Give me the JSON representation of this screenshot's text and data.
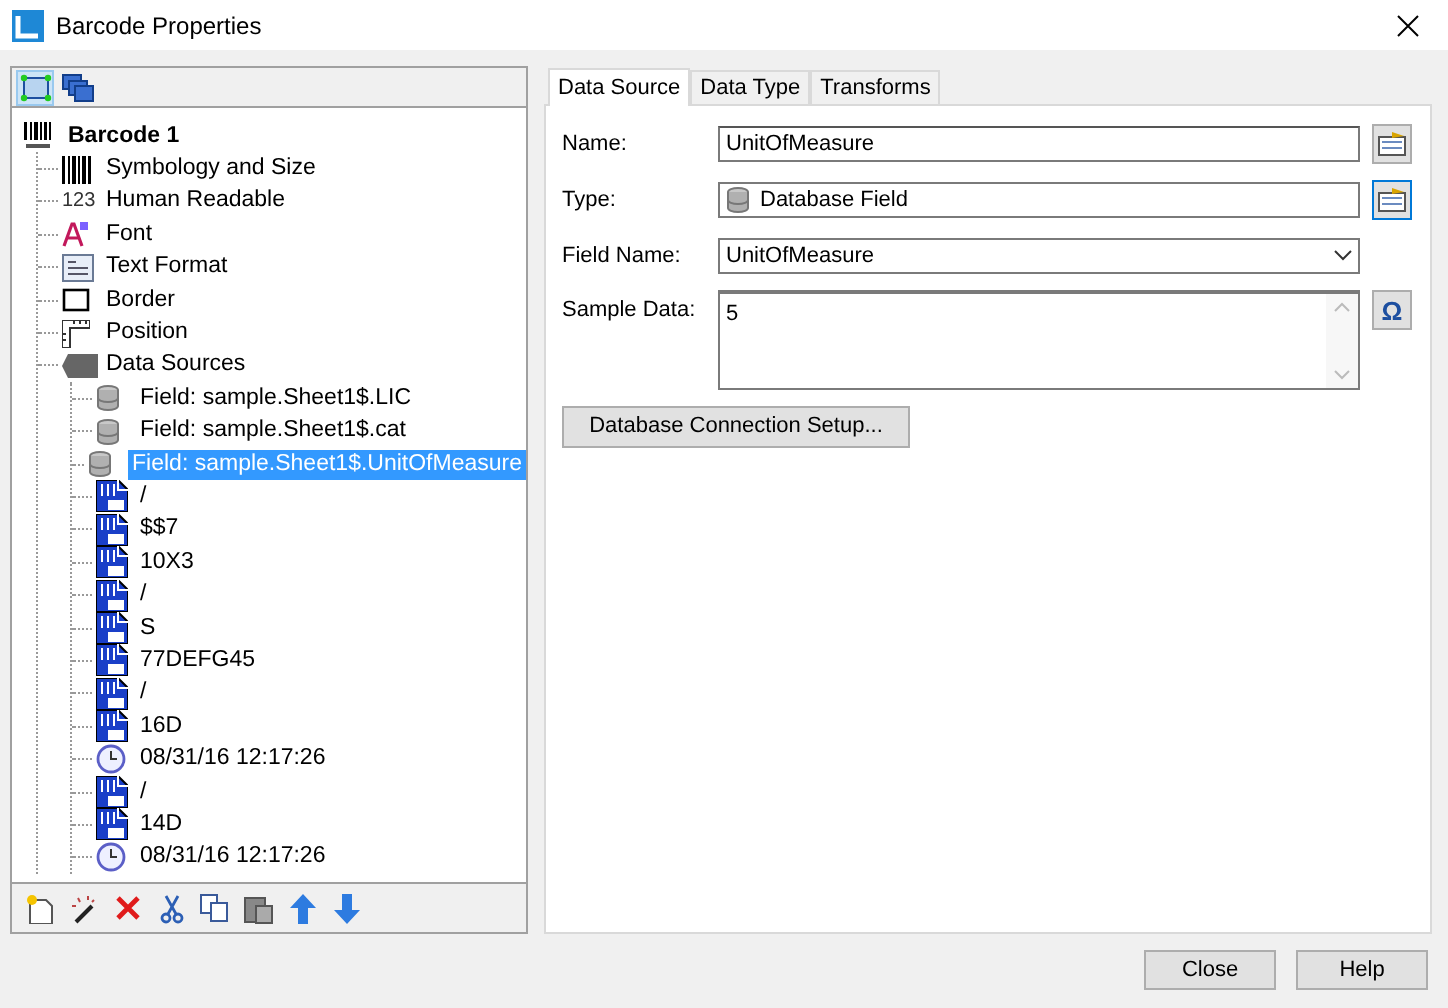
{
  "window": {
    "title": "Barcode Properties"
  },
  "left_toolbar": [
    {
      "kind": "layout",
      "selected": true
    },
    {
      "kind": "layers",
      "selected": false
    }
  ],
  "tree": {
    "label": "Barcode 1",
    "kind": "barcode",
    "selected": false,
    "children": [
      {
        "label": "Symbology and Size",
        "kind": "bars",
        "selected": false
      },
      {
        "label": "Human Readable",
        "kind": "digits",
        "icon_text": "123",
        "selected": false
      },
      {
        "label": "Font",
        "kind": "font",
        "selected": false
      },
      {
        "label": "Text Format",
        "kind": "textformat",
        "selected": false
      },
      {
        "label": "Border",
        "kind": "border",
        "selected": false
      },
      {
        "label": "Position",
        "kind": "position",
        "selected": false
      },
      {
        "label": "Data Sources",
        "kind": "sources",
        "selected": false,
        "children": [
          {
            "label": "Field: sample.Sheet1$.LIC",
            "kind": "field",
            "selected": false
          },
          {
            "label": "Field: sample.Sheet1$.cat",
            "kind": "field",
            "selected": false
          },
          {
            "label": "Field: sample.Sheet1$.UnitOfMeasure",
            "kind": "field",
            "selected": true
          },
          {
            "label": "/",
            "kind": "text",
            "selected": false
          },
          {
            "label": "$$7",
            "kind": "text",
            "selected": false
          },
          {
            "label": "10X3",
            "kind": "text",
            "selected": false
          },
          {
            "label": "/",
            "kind": "text",
            "selected": false
          },
          {
            "label": "S",
            "kind": "text",
            "selected": false
          },
          {
            "label": "77DEFG45",
            "kind": "text",
            "selected": false
          },
          {
            "label": "/",
            "kind": "text",
            "selected": false
          },
          {
            "label": "16D",
            "kind": "text",
            "selected": false
          },
          {
            "label": "08/31/16 12:17:26",
            "kind": "date",
            "selected": false
          },
          {
            "label": "/",
            "kind": "text",
            "selected": false
          },
          {
            "label": "14D",
            "kind": "text",
            "selected": false
          },
          {
            "label": "08/31/16 12:17:26",
            "kind": "date",
            "selected": false
          }
        ]
      }
    ]
  },
  "bottom_toolbar": [
    {
      "kind": "new"
    },
    {
      "kind": "wand"
    },
    {
      "kind": "delete"
    },
    {
      "kind": "cut"
    },
    {
      "kind": "copy"
    },
    {
      "kind": "paste"
    },
    {
      "kind": "up"
    },
    {
      "kind": "down"
    }
  ],
  "tabs": [
    {
      "label": "Data Source",
      "selected": true
    },
    {
      "label": "Data Type",
      "selected": false
    },
    {
      "label": "Transforms",
      "selected": false
    }
  ],
  "form": {
    "name": {
      "label": "Name:",
      "value": "UnitOfMeasure"
    },
    "type": {
      "label": "Type:",
      "value": "Database Field"
    },
    "field_name": {
      "label": "Field Name:",
      "value": "UnitOfMeasure"
    },
    "sample_data": {
      "label": "Sample Data:",
      "value": "5",
      "side_button": "Ω"
    },
    "setup_button": "Database Connection Setup..."
  },
  "buttons": [
    "Close",
    "Help"
  ]
}
